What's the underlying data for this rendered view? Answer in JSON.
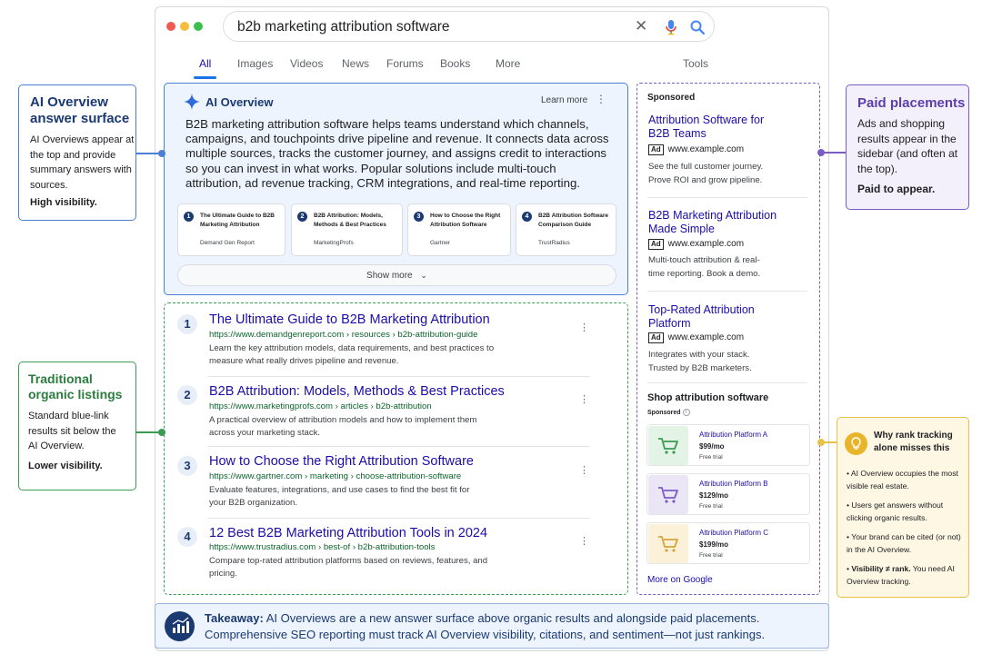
{
  "search": {
    "query": "b2b marketing attribution software"
  },
  "tabs": [
    "All",
    "Images",
    "Videos",
    "News",
    "Forums",
    "Books",
    "More",
    "Tools"
  ],
  "ai_overview": {
    "title": "AI Overview",
    "learn_more": "Learn more",
    "body": "B2B marketing attribution software helps teams understand which channels, campaigns, and touchpoints drive pipeline and revenue. It connects data across multiple sources, tracks the customer journey, and assigns credit to interactions so you can invest in what works. Popular solutions include multi-touch attribution, ad revenue tracking, CRM integrations, and real-time reporting.",
    "sources": [
      {
        "n": "1",
        "title": "The Ultimate Guide to B2B Marketing Attribution",
        "site": "Demand Gen Report"
      },
      {
        "n": "2",
        "title": "B2B Attribution: Models, Methods & Best Practices",
        "site": "MarketingProfs"
      },
      {
        "n": "3",
        "title": "How to Choose the Right Attribution Software",
        "site": "Gartner"
      },
      {
        "n": "4",
        "title": "B2B Attribution Software Comparison Guide",
        "site": "TrustRadius"
      }
    ],
    "show_more": "Show more"
  },
  "results": [
    {
      "n": "1",
      "title": "The Ultimate Guide to B2B Marketing Attribution",
      "url": "https://www.demandgenreport.com › resources › b2b-attribution-guide",
      "desc": "Learn the key attribution models, data requirements, and best practices to measure what really drives pipeline and revenue."
    },
    {
      "n": "2",
      "title": "B2B Attribution: Models, Methods & Best Practices",
      "url": "https://www.marketingprofs.com › articles › b2b-attribution",
      "desc": "A practical overview of attribution models and how to implement them across your marketing stack."
    },
    {
      "n": "3",
      "title": "How to Choose the Right Attribution Software",
      "url": "https://www.gartner.com › marketing › choose-attribution-software",
      "desc": "Evaluate features, integrations, and use cases to find the best fit for your B2B organization."
    },
    {
      "n": "4",
      "title": "12 Best B2B Marketing Attribution Tools in 2024",
      "url": "https://www.trustradius.com › best-of › b2b-attribution-tools",
      "desc": "Compare top-rated attribution platforms based on reviews, features, and pricing."
    }
  ],
  "sidebar": {
    "sponsored": "Sponsored",
    "ads": [
      {
        "title": "Attribution Software for B2B Teams",
        "badge": "Ad",
        "domain": "www.example.com",
        "desc": "See the full customer journey. Prove ROI and grow pipeline."
      },
      {
        "title": "B2B Marketing Attribution Made Simple",
        "badge": "Ad",
        "domain": "www.example.com",
        "desc": "Multi-touch attribution & real-time reporting. Book a demo."
      },
      {
        "title": "Top-Rated Attribution Platform",
        "badge": "Ad",
        "domain": "www.example.com",
        "desc": "Integrates with your stack. Trusted by B2B marketers."
      }
    ],
    "shop_title": "Shop attribution software",
    "shop_sponsored": "Sponsored",
    "products": [
      {
        "name": "Attribution Platform A",
        "price": "$99/mo",
        "trial": "Free trial",
        "color": "#e3f3e6"
      },
      {
        "name": "Attribution Platform B",
        "price": "$129/mo",
        "trial": "Free trial",
        "color": "#ebe6f6"
      },
      {
        "name": "Attribution Platform C",
        "price": "$199/mo",
        "trial": "Free trial",
        "color": "#fbf1d9"
      }
    ],
    "more": "More on Google"
  },
  "callouts": {
    "ai_overview": {
      "title": "AI Overview answer surface",
      "body": "AI Overviews appear at the top and provide summary answers with sources.",
      "footer": "High visibility."
    },
    "organic": {
      "title": "Traditional organic listings",
      "body": "Standard blue-link results sit below the AI Overview.",
      "footer": "Lower visibility."
    },
    "paid": {
      "title": "Paid placements",
      "body": "Ads and shopping results appear in the sidebar (and often at the top).",
      "footer": "Paid to appear."
    },
    "tracking": {
      "title": "Why rank tracking alone misses this",
      "bullets": [
        "AI Overview occupies the most visible real estate.",
        "Users get answers without clicking organic results.",
        "Your brand can be cited (or not) in the AI Overview."
      ],
      "last_bold": "Visibility ≠ rank.",
      "last_rest": " You need AI Overview tracking."
    }
  },
  "takeaway": {
    "label": "Takeaway:",
    "text": " AI Overviews are a new answer surface above organic results and alongside paid placements. Comprehensive SEO reporting must track AI Overview visibility, citations, and sentiment—not just rankings."
  },
  "colors": {
    "ai_blue": "#4a7fd4",
    "organic_green": "#3a9b52",
    "paid_purple": "#7b5cc4",
    "tracking_yellow": "#e8c14a",
    "link": "#1a0dab"
  }
}
